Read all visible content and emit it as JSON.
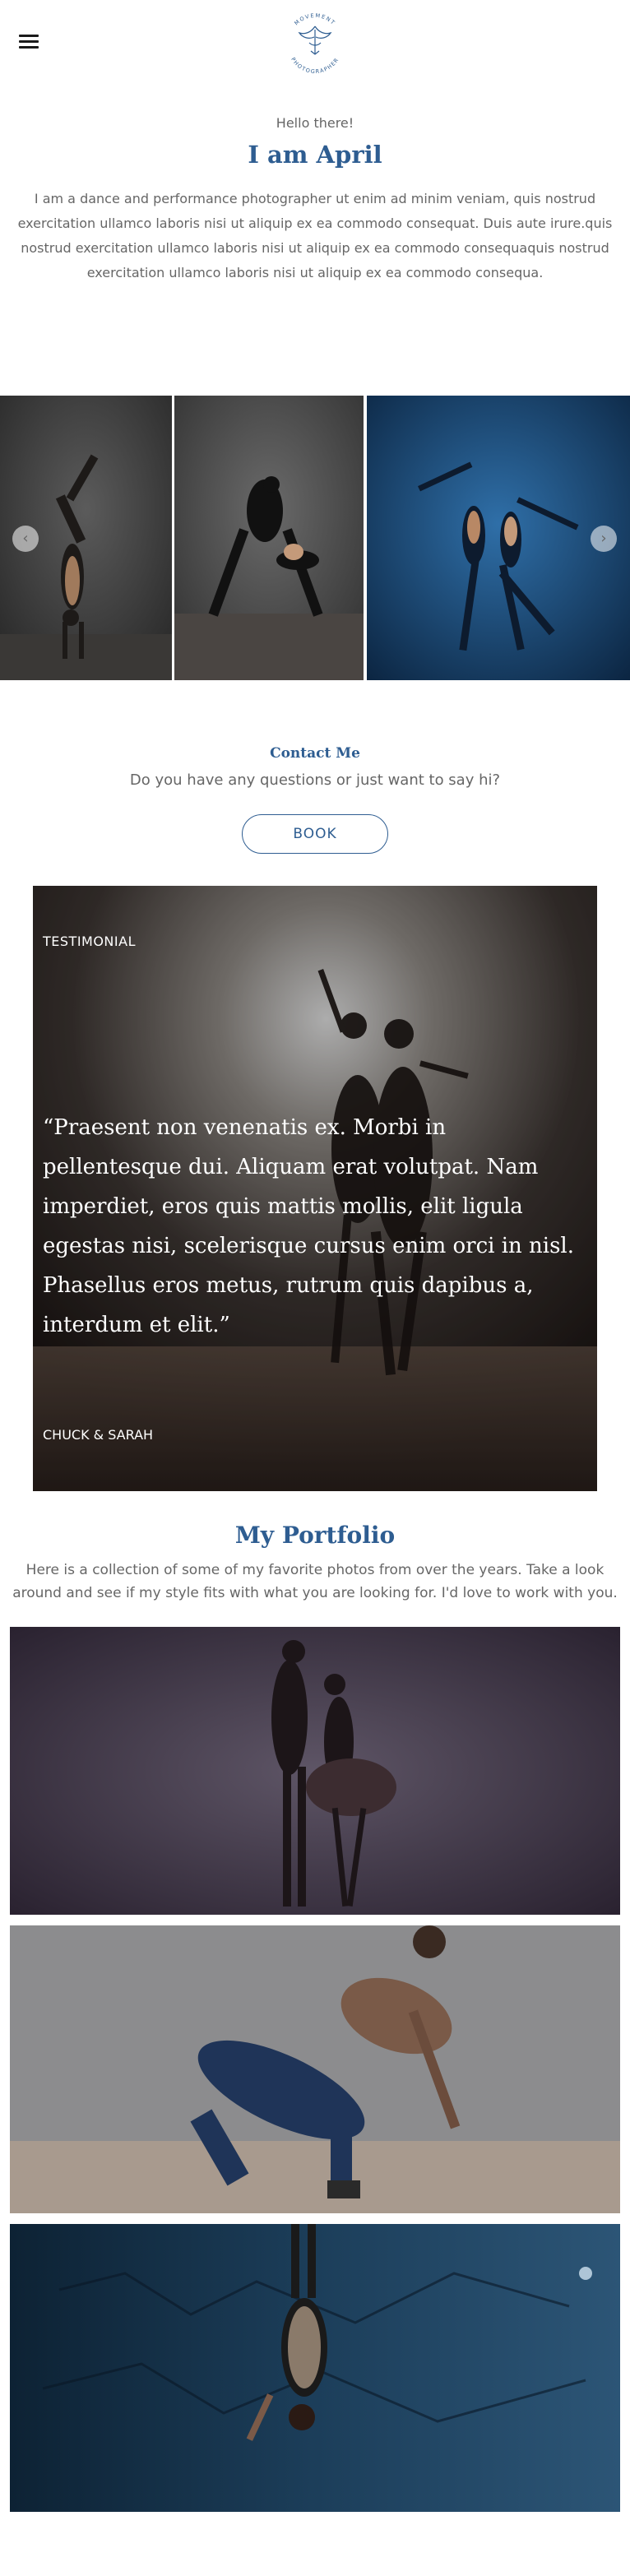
{
  "header": {
    "logo_text_top": "MOVEMENT",
    "logo_text_bottom": "PHOTOGRAPHER"
  },
  "intro": {
    "greeting": "Hello there!",
    "name": "I am April",
    "bio": "I am a dance and performance photographer ut enim ad minim veniam, quis nostrud exercitation ullamco laboris nisi ut aliquip ex ea commodo consequat. Duis aute irure.quis nostrud exercitation ullamco laboris nisi ut aliquip ex ea commodo consequaquis nostrud exercitation ullamco laboris nisi ut aliquip ex ea commodo consequa."
  },
  "gallery": {
    "prev_icon": "chevron-left-icon",
    "next_icon": "chevron-right-icon"
  },
  "contact": {
    "title": "Contact Me",
    "subtitle": "Do you have any questions or just want to say hi?",
    "button_label": "BOOK"
  },
  "testimonial": {
    "label": "TESTIMONIAL",
    "quote": "“Praesent non venenatis ex. Morbi in pellentesque dui. Aliquam erat volutpat. Nam imperdiet, eros quis mattis mollis, elit ligula egestas nisi, scelerisque cursus enim orci in nisl. Phasellus eros metus, rutrum quis dapibus a, interdum et elit.”",
    "author": "CHUCK & SARAH"
  },
  "portfolio": {
    "title": "My Portfolio",
    "description": "Here is a collection of some of my favorite photos from over the years. Take a look around and see if my style fits with what you are looking for. I'd love to work with you."
  },
  "colors": {
    "accent": "#2e5d91",
    "body_text": "#666666"
  }
}
